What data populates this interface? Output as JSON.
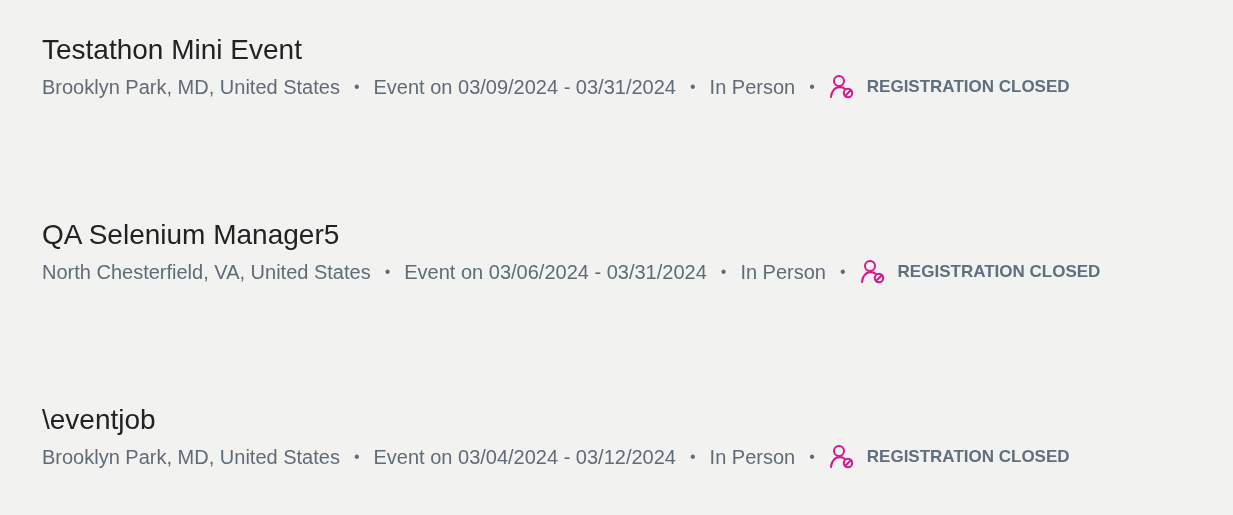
{
  "events": [
    {
      "title": "Testathon Mini Event",
      "location": "Brooklyn Park, MD, United States",
      "dates": "Event on 03/09/2024 - 03/31/2024",
      "format": "In Person",
      "separator": "•",
      "status": "REGISTRATION CLOSED"
    },
    {
      "title": "QA Selenium Manager5",
      "location": "North Chesterfield, VA, United States",
      "dates": "Event on 03/06/2024 - 03/31/2024",
      "format": "In Person",
      "separator": "•",
      "status": "REGISTRATION CLOSED"
    },
    {
      "title": "\\eventjob",
      "location": "Brooklyn Park, MD, United States",
      "dates": "Event on 03/04/2024 - 03/12/2024",
      "format": "In Person",
      "separator": "•",
      "status": "REGISTRATION CLOSED"
    }
  ]
}
